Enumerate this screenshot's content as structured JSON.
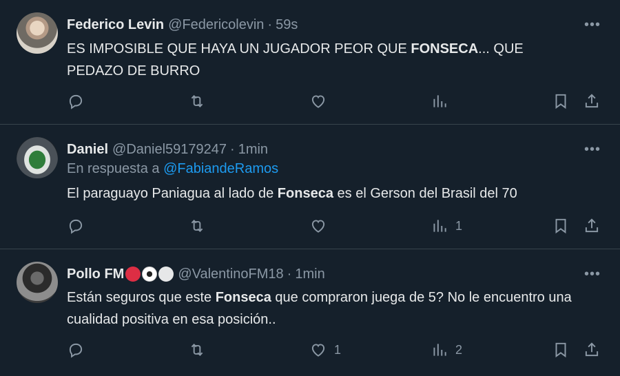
{
  "tweets": [
    {
      "name": "Federico Levin",
      "handle": "@Federicolevin",
      "time": "59s",
      "text_before": "ES IMPOSIBLE QUE HAYA UN JUGADOR PEOR QUE ",
      "text_bold": "FONSECA",
      "text_after": "... QUE PEDAZO DE BURRO",
      "replies": "",
      "retweets": "",
      "likes": "",
      "views": ""
    },
    {
      "name": "Daniel",
      "handle": "@Daniel59179247",
      "time": "1min",
      "reply_prefix": "En respuesta a ",
      "reply_mention": "@FabiandeRamos",
      "text_before": "El paraguayo Paniagua al lado de ",
      "text_bold": "Fonseca",
      "text_after": " es el Gerson del Brasil del 70",
      "replies": "",
      "retweets": "",
      "likes": "",
      "views": "1"
    },
    {
      "name": "Pollo FM",
      "handle": "@ValentinoFM18",
      "time": "1min",
      "text_before": "Están seguros que este ",
      "text_bold": "Fonseca",
      "text_after": " que compraron juega de 5? No le encuentro una cualidad positiva en esa posición..",
      "replies": "",
      "retweets": "",
      "likes": "1",
      "views": "2"
    }
  ],
  "ui": {
    "separator_dot": "·",
    "more_glyph": "•••"
  },
  "colors": {
    "background": "#15202b",
    "text": "#e7e9ea",
    "muted": "#8b98a5",
    "link": "#1d9bf0",
    "border": "#38444d"
  },
  "icons": [
    "reply-icon",
    "retweet-icon",
    "like-icon",
    "views-icon",
    "bookmark-icon",
    "share-icon",
    "more-icon"
  ]
}
